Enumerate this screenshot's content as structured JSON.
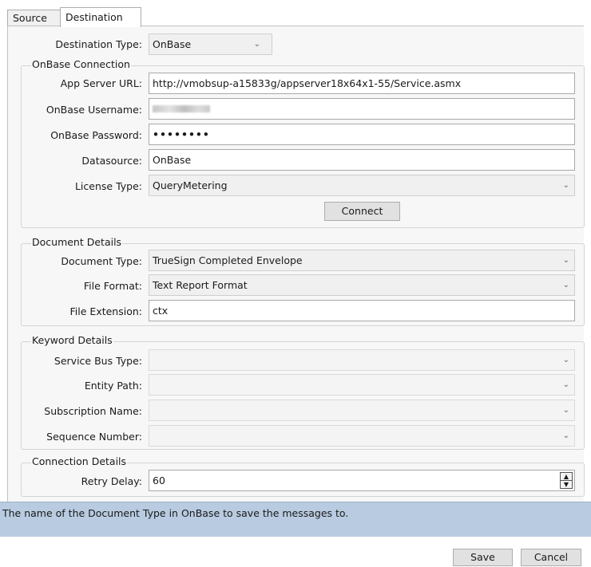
{
  "tabs": [
    "Source",
    "Destination"
  ],
  "destination_type": {
    "label": "Destination Type:",
    "value": "OnBase"
  },
  "onbase_connection": {
    "title": "OnBase Connection",
    "app_server_url_label": "App Server URL:",
    "app_server_url": "http://vmobsup-a15833g/appserver18x64x1-55/Service.asmx",
    "username_label": "OnBase Username:",
    "password_label": "OnBase Password:",
    "password": "••••••••",
    "datasource_label": "Datasource:",
    "datasource": "OnBase",
    "license_type_label": "License Type:",
    "license_type": "QueryMetering",
    "connect_label": "Connect"
  },
  "document_details": {
    "title": "Document Details",
    "document_type_label": "Document Type:",
    "document_type": "TrueSign Completed Envelope",
    "file_format_label": "File Format:",
    "file_format": "Text Report Format",
    "file_extension_label": "File Extension:",
    "file_extension": "ctx"
  },
  "keyword_details": {
    "title": "Keyword Details",
    "service_bus_type_label": "Service Bus Type:",
    "entity_path_label": "Entity Path:",
    "subscription_name_label": "Subscription Name:",
    "sequence_number_label": "Sequence Number:"
  },
  "connection_details": {
    "title": "Connection Details",
    "retry_delay_label": "Retry Delay:",
    "retry_delay": "60"
  },
  "status_text": "The name of the Document Type in OnBase to save the messages to.",
  "footer": {
    "save_label": "Save",
    "cancel_label": "Cancel"
  },
  "icons": {
    "dropdown": "chevron-down-icon",
    "spinner": "spinner-arrows-icon"
  }
}
